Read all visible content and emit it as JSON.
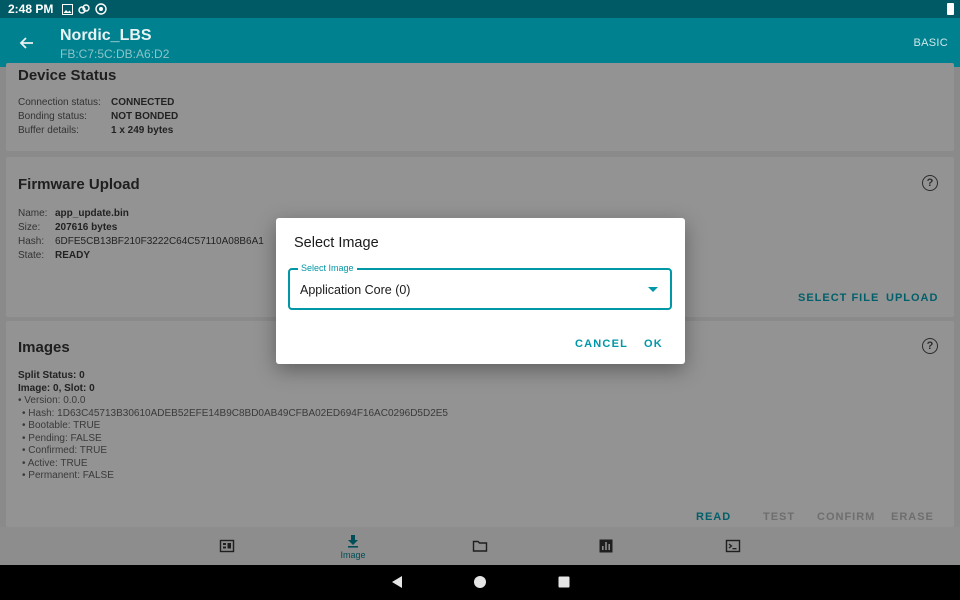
{
  "status_bar": {
    "time": "2:48 PM"
  },
  "app_bar": {
    "title": "Nordic_LBS",
    "subtitle": "FB:C7:5C:DB:A6:D2",
    "mode": "BASIC"
  },
  "device_status": {
    "title": "Device Status",
    "rows": [
      {
        "label": "Connection status:",
        "value": "CONNECTED"
      },
      {
        "label": "Bonding status:",
        "value": "NOT BONDED"
      },
      {
        "label": "Buffer details:",
        "value": "1 x 249 bytes"
      }
    ]
  },
  "firmware_upload": {
    "title": "Firmware Upload",
    "rows": [
      {
        "label": "Name:",
        "value": "app_update.bin"
      },
      {
        "label": "Size:",
        "value": "207616 bytes"
      },
      {
        "label": "Hash:",
        "value": "6DFE5CB13BF210F3222C64C57110A08B6A1"
      },
      {
        "label": "State:",
        "value": "READY"
      }
    ],
    "select_file": "SELECT FILE",
    "upload": "UPLOAD"
  },
  "images": {
    "title": "Images",
    "split_status": "Split Status: 0",
    "image_slot": "Image: 0, Slot: 0",
    "details": [
      "• Version: 0.0.0",
      "  • Hash: 1D63C45713B30610ADEB52EFE14B9C8BD0AB49CFBA02ED694F16AC0296D5D2E5",
      "  • Bootable: TRUE",
      "  • Pending: FALSE",
      "  • Confirmed: TRUE",
      "  • Active: TRUE",
      "  • Permanent: FALSE"
    ],
    "actions": {
      "read": "READ",
      "test": "TEST",
      "confirm": "CONFIRM",
      "erase": "ERASE"
    }
  },
  "bottom_nav": {
    "image_label": "Image"
  },
  "dialog": {
    "title": "Select Image",
    "field_label": "Select Image",
    "field_value": "Application Core (0)",
    "cancel": "CANCEL",
    "ok": "OK"
  },
  "colors": {
    "accent": "#0097a7",
    "app_bar": "#00818f",
    "status_bar": "#005a66"
  }
}
